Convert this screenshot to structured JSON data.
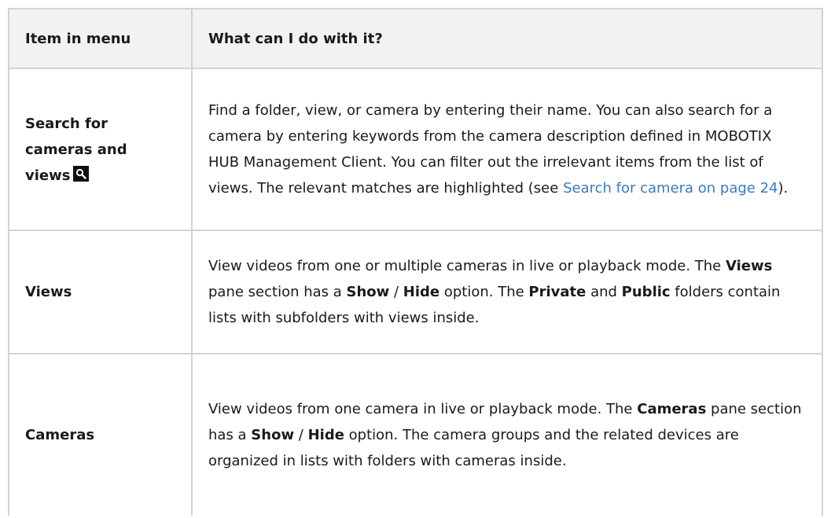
{
  "table": {
    "headers": {
      "item": "Item in menu",
      "description": "What can I do with it?"
    },
    "rows": [
      {
        "item": "Search for cameras and views",
        "icon": "search-icon",
        "description": {
          "text": "Find a folder, view, or camera by entering their name. You can also search for a camera by entering keywords from the camera description defined in MOBOTIX HUB Management Client. You can filter out the irrelevant items from the list of views. The relevant matches are highlighted (see ",
          "link": "Search for camera on page 24",
          "after_link": ")."
        }
      },
      {
        "item": "Views",
        "description": {
          "p1": "View videos from one or multiple cameras in live or playback mode. The ",
          "b1": "Views",
          "p2": " pane section has a ",
          "b2": "Show",
          "p3": " / ",
          "b3": "Hide",
          "p4": " option. The ",
          "b4": "Private",
          "p5": " and ",
          "b5": "Public",
          "p6": " folders contain lists with subfolders with views inside."
        }
      },
      {
        "item": "Cameras",
        "description": {
          "p1": "View videos from one camera in live or playback mode. The ",
          "b1": "Cameras",
          "p2": " pane section has a ",
          "b2": "Show",
          "p3": " / ",
          "b3": "Hide",
          "p4": " option. The camera groups and the related devices are organized in lists with folders with cameras inside."
        }
      }
    ]
  }
}
